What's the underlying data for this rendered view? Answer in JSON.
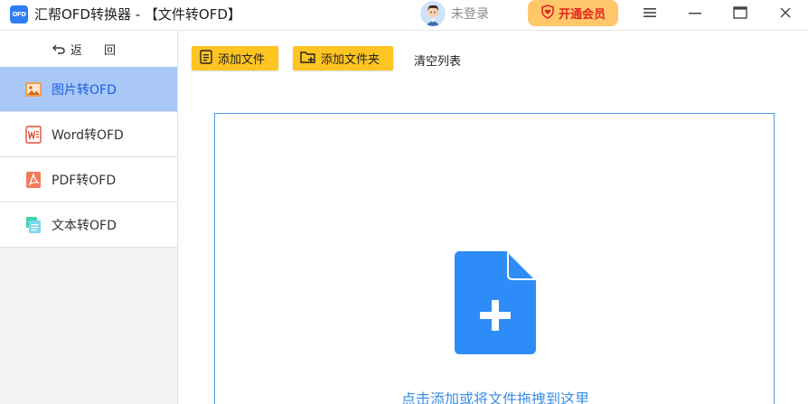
{
  "window": {
    "logo_text": "OFD",
    "title": "汇帮OFD转换器 - 【文件转OFD】",
    "login_text": "未登录",
    "vip_label": "开通会员"
  },
  "sidebar": {
    "back_label": "返 回",
    "items": [
      {
        "label": "图片转OFD",
        "icon": "image-icon",
        "active": true
      },
      {
        "label": "Word转OFD",
        "icon": "word-icon",
        "active": false
      },
      {
        "label": "PDF转OFD",
        "icon": "pdf-icon",
        "active": false
      },
      {
        "label": "文本转OFD",
        "icon": "text-file-icon",
        "active": false
      }
    ]
  },
  "toolbar": {
    "add_file": "添加文件",
    "add_folder": "添加文件夹",
    "clear_list": "清空列表"
  },
  "dropzone": {
    "hint": "点击添加或将文件拖拽到这里"
  },
  "colors": {
    "accent_blue": "#2e8cf8",
    "toolbar_yellow": "#ffc421",
    "active_nav": "#a9c8f7",
    "vip_bg": "#ffc76a"
  }
}
